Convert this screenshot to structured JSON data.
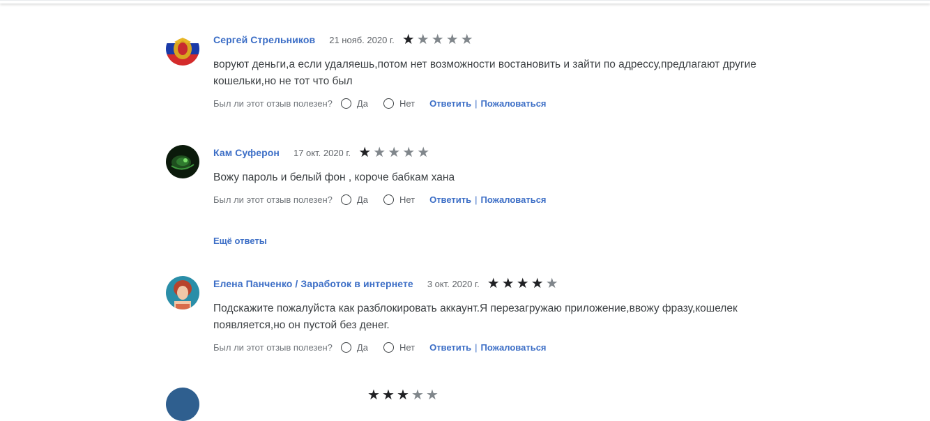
{
  "reviews": [
    {
      "author": "Сергей Стрельников",
      "date": "21 нояб. 2020 г.",
      "rating": 1,
      "text": "воруют деньги,а если удаляешь,потом нет возможности востановить и зайти по адрессу,предлагают другие кошельки,но не тот что был",
      "avatar_colors": [
        "#1a3aa8",
        "#d42b2b",
        "#ffffff",
        "#e8b624"
      ]
    },
    {
      "author": "Кам Суферон",
      "date": "17 окт. 2020 г.",
      "rating": 1,
      "text": "Вожу пароль и белый фон , короче бабкам хана",
      "avatar_colors": [
        "#0b1a0b",
        "#2f7a2f",
        "#7be06a"
      ]
    },
    {
      "author": "Елена Панченко / Заработок в интернете",
      "date": "3 окт. 2020 г.",
      "rating": 4,
      "text": "Подскажите пожалуйста как разблокировать аккаунт.Я перезагружаю приложение,ввожу фразу,кошелек появляется,но он пустой без денег.",
      "avatar_colors": [
        "#2a8ea8",
        "#b8432c",
        "#f1c7a8"
      ]
    }
  ],
  "footer": {
    "question": "Был ли этот отзыв полезен?",
    "yes": "Да",
    "no": "Нет",
    "reply": "Ответить",
    "separator": "|",
    "report": "Пожаловаться"
  },
  "more_replies": "Ещё ответы",
  "colors": {
    "link": "#3c6ec6",
    "star_on": "#202124",
    "star_off": "#80868b"
  }
}
